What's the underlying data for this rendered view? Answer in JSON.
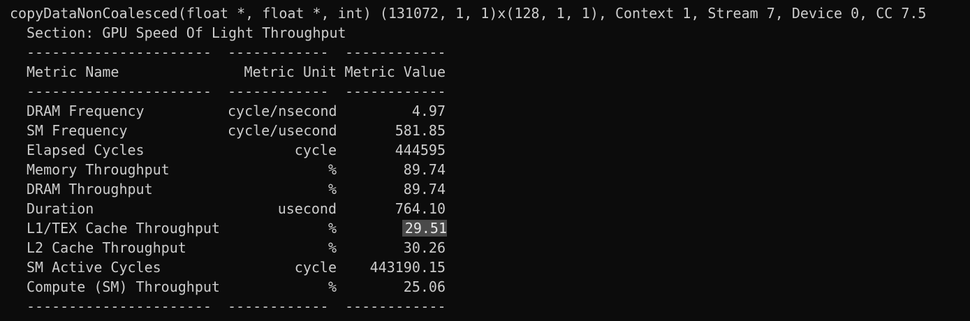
{
  "header": {
    "kernel_line": "copyDataNonCoalesced(float *, float *, int) (131072, 1, 1)x(128, 1, 1), Context 1, Stream 7, Device 0, CC 7.5",
    "section": "Section: GPU Speed Of Light Throughput"
  },
  "table": {
    "separator_name": "----------------------",
    "separator_unit": "------------",
    "separator_value": "------------",
    "columns": {
      "name": "Metric Name",
      "unit": "Metric Unit",
      "value": "Metric Value"
    },
    "rows": [
      {
        "name": "DRAM Frequency",
        "unit": "cycle/nsecond",
        "value": "4.97"
      },
      {
        "name": "SM Frequency",
        "unit": "cycle/usecond",
        "value": "581.85"
      },
      {
        "name": "Elapsed Cycles",
        "unit": "cycle",
        "value": "444595"
      },
      {
        "name": "Memory Throughput",
        "unit": "%",
        "value": "89.74"
      },
      {
        "name": "DRAM Throughput",
        "unit": "%",
        "value": "89.74"
      },
      {
        "name": "Duration",
        "unit": "usecond",
        "value": "764.10"
      },
      {
        "name": "L1/TEX Cache Throughput",
        "unit": "%",
        "value": "29.51"
      },
      {
        "name": "L2 Cache Throughput",
        "unit": "%",
        "value": "30.26"
      },
      {
        "name": "SM Active Cycles",
        "unit": "cycle",
        "value": "443190.15"
      },
      {
        "name": "Compute (SM) Throughput",
        "unit": "%",
        "value": "25.06"
      }
    ],
    "selected_row_index": 6
  },
  "colors": {
    "background": "#0c0c0c",
    "text": "#cccccc",
    "selection": "#4a4a4a"
  }
}
